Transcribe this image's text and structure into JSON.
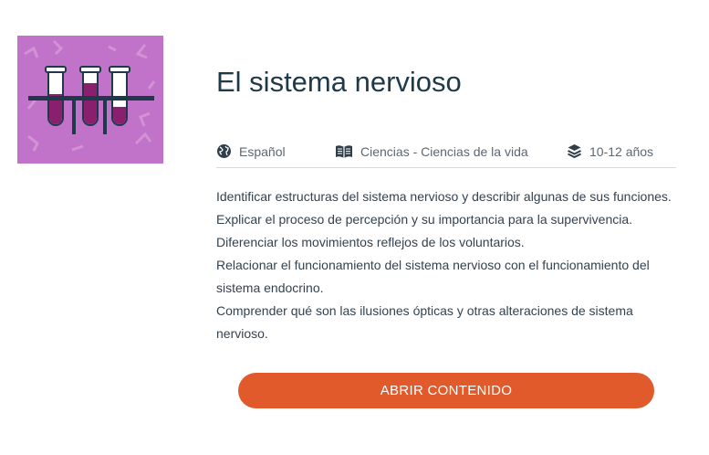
{
  "course": {
    "title": "El sistema nervioso",
    "thumbnail_icon": "test-tubes-icon",
    "thumbnail_bg": "#c173c9"
  },
  "meta": {
    "language": {
      "icon": "globe-icon",
      "label": "Español"
    },
    "subject": {
      "icon": "book-icon",
      "label": "Ciencias - Ciencias de la vida"
    },
    "age": {
      "icon": "layers-icon",
      "label": "10-12 años"
    }
  },
  "description": [
    "Identificar estructuras del sistema nervioso y describir algunas de sus funciones.",
    "Explicar el proceso de percepción y su importancia para la supervivencia.",
    "Diferenciar los movimientos reflejos de los voluntarios.",
    "Relacionar el funcionamiento del sistema nervioso con el funcionamiento del sistema endocrino.",
    "Comprender qué son las ilusiones ópticas y otras alteraciones de sistema nervioso."
  ],
  "actions": {
    "open_label": "ABRIR CONTENIDO"
  },
  "colors": {
    "accent": "#e05a2b",
    "title": "#1e3a4a",
    "liquid": "#8a1f6e"
  }
}
